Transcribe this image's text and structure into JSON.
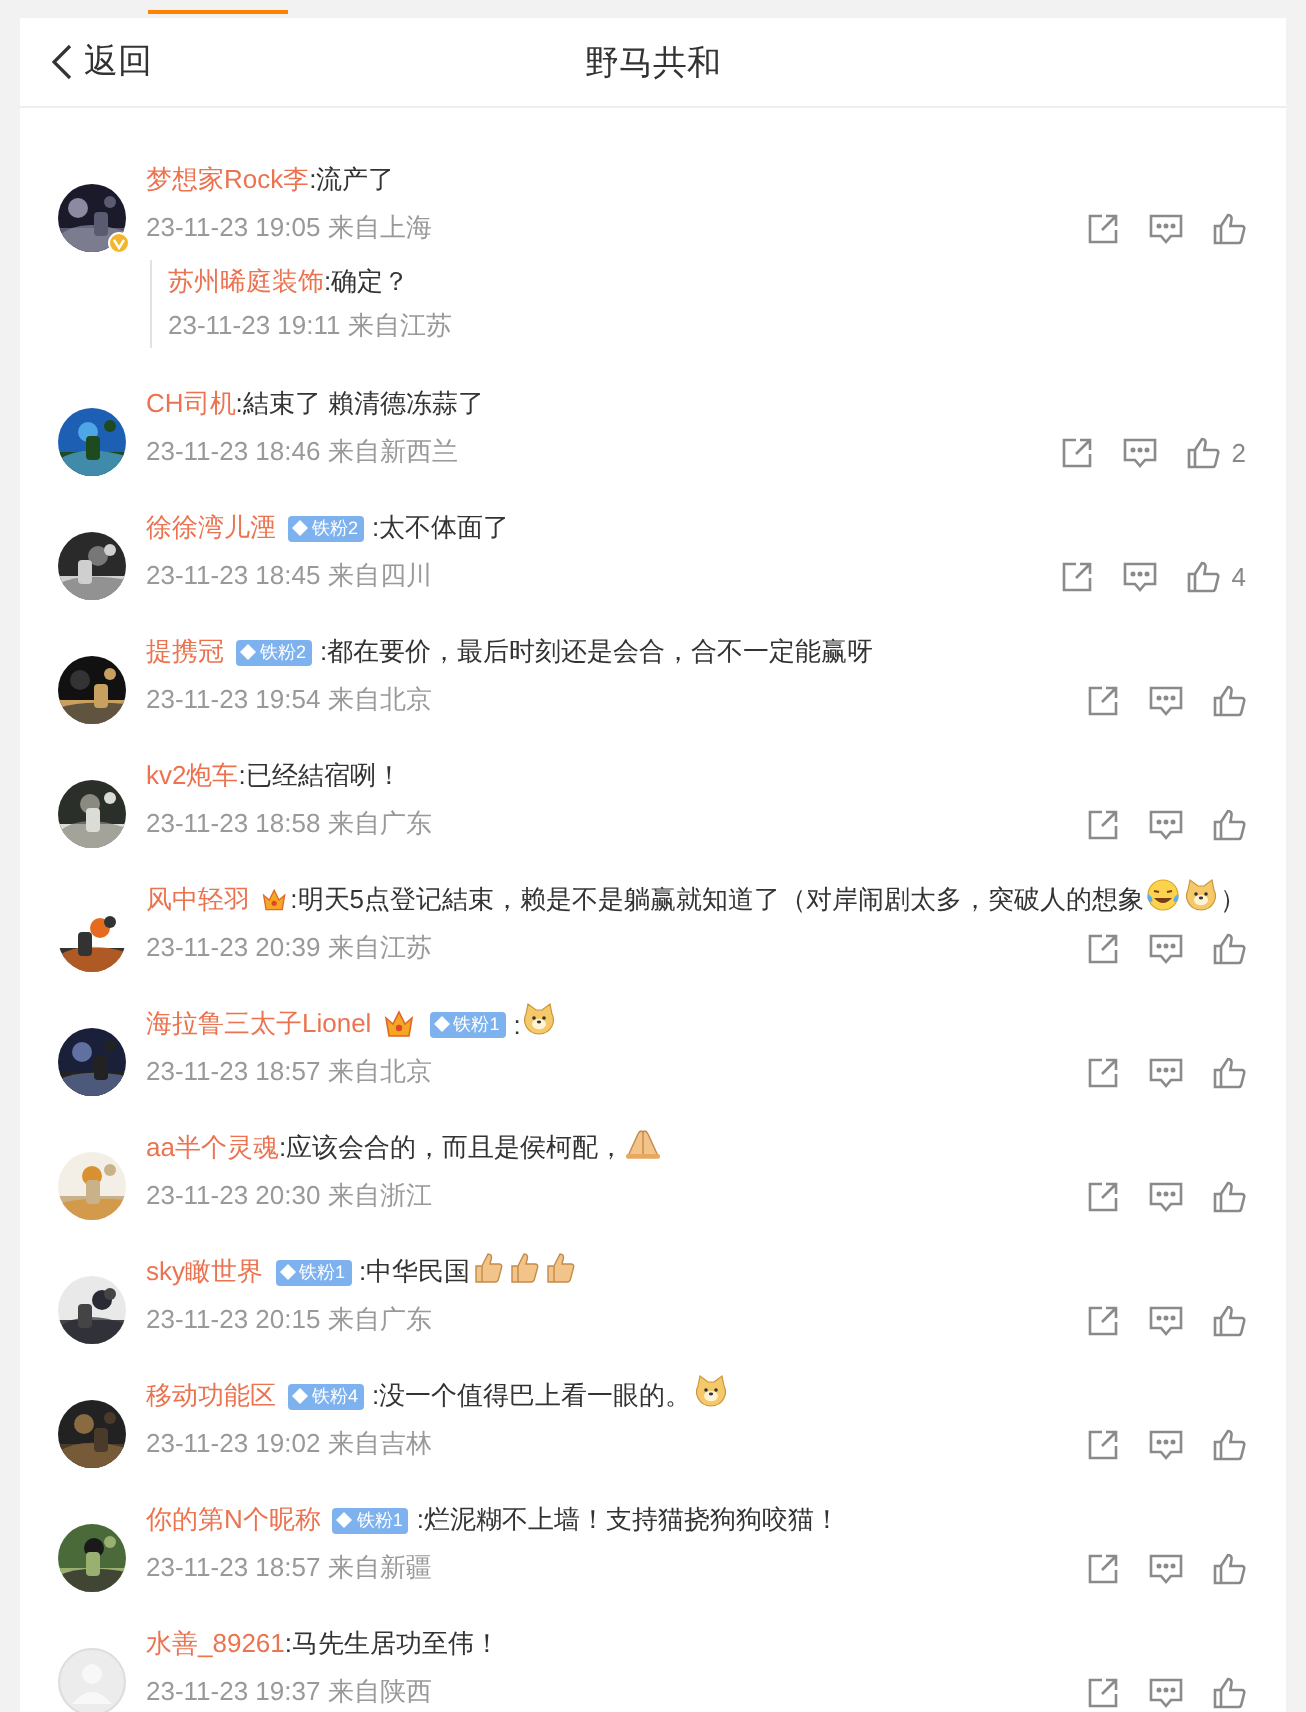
{
  "top_tab": {
    "selected": true
  },
  "header": {
    "back": "返回",
    "title": "野马共和"
  },
  "comments": [
    {
      "user": "梦想家Rock李",
      "avatar": {
        "kind": "picture",
        "verified": true
      },
      "content": [
        {
          "kind": "text",
          "text": ":流产了"
        }
      ],
      "meta": "23-11-23 19:05 来自上海",
      "reply": {
        "user": "苏州晞庭装饰",
        "content": [
          {
            "kind": "text",
            "text": ":确定？"
          }
        ],
        "meta": "23-11-23 19:11 来自江苏"
      }
    },
    {
      "user": "CH司机",
      "avatar": {
        "kind": "picture"
      },
      "content": [
        {
          "kind": "text",
          "text": ":結束了 賴清德冻蒜了"
        }
      ],
      "meta": "23-11-23 18:46 来自新西兰",
      "likes": "2"
    },
    {
      "user": "徐徐湾儿湮",
      "avatar": {
        "kind": "picture"
      },
      "badge": "铁粉2",
      "content": [
        {
          "kind": "text",
          "text": ":太不体面了"
        }
      ],
      "meta": "23-11-23 18:45 来自四川",
      "likes": "4"
    },
    {
      "user": "提携冠",
      "avatar": {
        "kind": "picture"
      },
      "badge": "铁粉2",
      "content": [
        {
          "kind": "text",
          "text": ":都在要价，最后时刻还是会合，合不一定能赢呀"
        }
      ],
      "meta": "23-11-23 19:54 来自北京"
    },
    {
      "user": "kv2炮车",
      "avatar": {
        "kind": "picture"
      },
      "content": [
        {
          "kind": "text",
          "text": ":已经結宿咧！"
        }
      ],
      "meta": "23-11-23 18:58 来自广东"
    },
    {
      "user": "风中轻羽",
      "avatar": {
        "kind": "picture"
      },
      "crown": true,
      "content": [
        {
          "kind": "text",
          "text": ":明天5点登记結束，赖是不是躺赢就知道了（对岸闹剧太多，突破人的想象"
        },
        {
          "kind": "laugh"
        },
        {
          "kind": "dog"
        },
        {
          "kind": "text",
          "text": "）"
        }
      ],
      "meta": "23-11-23 20:39 来自江苏"
    },
    {
      "user": "海拉鲁三太子Lionel",
      "avatar": {
        "kind": "picture"
      },
      "crown": true,
      "badge": "铁粉1",
      "content": [
        {
          "kind": "text",
          "text": ":"
        },
        {
          "kind": "dog"
        }
      ],
      "meta": "23-11-23 18:57 来自北京"
    },
    {
      "user": "aa半个灵魂",
      "avatar": {
        "kind": "picture"
      },
      "content": [
        {
          "kind": "text",
          "text": ":应该会合的，而且是侯柯配，"
        },
        {
          "kind": "pray"
        }
      ],
      "meta": "23-11-23 20:30 来自浙江"
    },
    {
      "user": "sky瞰世界",
      "avatar": {
        "kind": "picture"
      },
      "badge": "铁粉1",
      "content": [
        {
          "kind": "text",
          "text": ":中华民国"
        },
        {
          "kind": "thumb"
        },
        {
          "kind": "thumb"
        },
        {
          "kind": "thumb"
        }
      ],
      "meta": "23-11-23 20:15 来自广东"
    },
    {
      "user": "移动功能区",
      "avatar": {
        "kind": "picture"
      },
      "badge": "铁粉4",
      "content": [
        {
          "kind": "text",
          "text": ":没一个值得巴上看一眼的。"
        },
        {
          "kind": "dog"
        }
      ],
      "meta": "23-11-23 19:02 来自吉林"
    },
    {
      "user": "你的第N个昵称",
      "avatar": {
        "kind": "picture"
      },
      "badge": "铁粉1",
      "content": [
        {
          "kind": "text",
          "text": ":烂泥糊不上墙！支持猫挠狗狗咬猫！"
        }
      ],
      "meta": "23-11-23 18:57 来自新疆"
    },
    {
      "user": "水善_89261",
      "avatar": {
        "kind": "default"
      },
      "content": [
        {
          "kind": "text",
          "text": ":马先生居功至伟！"
        }
      ],
      "meta": "23-11-23 19:37 来自陕西"
    }
  ]
}
